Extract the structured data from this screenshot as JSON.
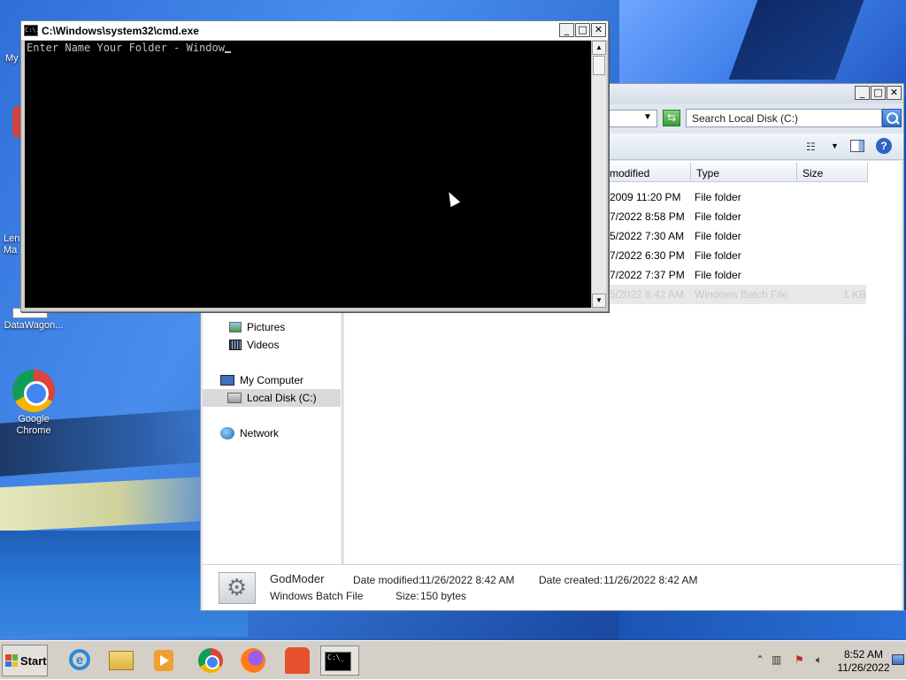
{
  "desktop": {
    "icons": [
      {
        "label": "My"
      },
      {
        "label": "Len"
      },
      {
        "label": "Ma"
      },
      {
        "label": "DataWagon..."
      },
      {
        "label": "Google Chrome"
      }
    ]
  },
  "cmd": {
    "title": "C:\\Windows\\system32\\cmd.exe",
    "output": "Enter Name Your Folder - Window",
    "icon_text": "C:\\."
  },
  "explorer": {
    "search_placeholder": "Search Local Disk (C:)",
    "toolbar_help": "?",
    "columns": [
      "modified",
      "Type",
      "Size"
    ],
    "rows": [
      {
        "date": "2009 11:20 PM",
        "type": "File folder",
        "size": ""
      },
      {
        "date": "7/2022 8:58 PM",
        "type": "File folder",
        "size": ""
      },
      {
        "date": "5/2022 7:30 AM",
        "type": "File folder",
        "size": ""
      },
      {
        "date": "7/2022 6:30 PM",
        "type": "File folder",
        "size": ""
      },
      {
        "date": "7/2022 7:37 PM",
        "type": "File folder",
        "size": ""
      },
      {
        "date": "5/2022 8:42 AM",
        "type": "Windows Batch File",
        "size": "1 KB"
      }
    ],
    "nav": {
      "pictures": "Pictures",
      "videos": "Videos",
      "my_computer": "My Computer",
      "local_disk": "Local Disk (C:)",
      "network": "Network"
    },
    "details": {
      "name": "GodModer",
      "kind": "Windows Batch File",
      "modified_label": "Date modified:",
      "modified_value": "11/26/2022 8:42 AM",
      "created_label": "Date created:",
      "created_value": "11/26/2022 8:42 AM",
      "size_label": "Size:",
      "size_value": "150 bytes"
    }
  },
  "taskbar": {
    "start_label": "Start",
    "ie_glyph": "e",
    "cmd_icon_text": "C:\\_",
    "clock_time": "8:52 AM",
    "clock_date": "11/26/2022"
  },
  "colors": {
    "desktop_blue": "#2f6fd6",
    "console_bg": "#000000",
    "console_fg": "#c0c0c0",
    "taskbar": "#d4d0c8"
  }
}
